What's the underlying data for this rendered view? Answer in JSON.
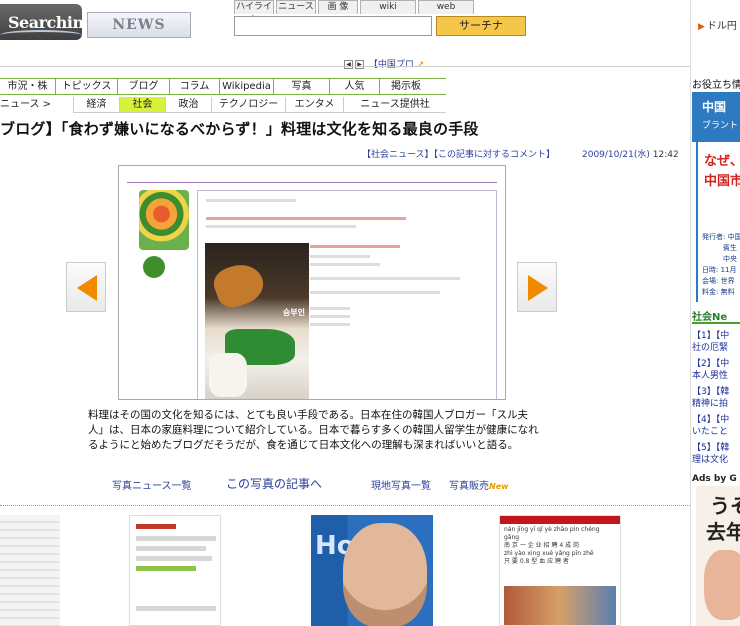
{
  "header": {
    "logo_text": "Searchina",
    "news_logo": "NEWS",
    "search_tabs": [
      "ハイライト",
      "ニュース",
      "画 像",
      "wiki",
      "web"
    ],
    "search_button": "サーチナ",
    "search_placeholder": "",
    "currency_link": "ドル円",
    "currency_icon": "arrow-bullet-icon"
  },
  "pager": {
    "label": "【中国プロ",
    "icon": "arrow-up-right-icon"
  },
  "nav": {
    "primary": [
      "市況・株",
      "トピックス",
      "ブログ",
      "コラム",
      "Wikipedia",
      "写真",
      "人気",
      "掲示板"
    ],
    "secondary_left": "ニュース >",
    "secondary": [
      "経済",
      "社会",
      "政治",
      "テクノロジー",
      "エンタメ",
      "ニュース提供社"
    ],
    "secondary_active": "社会"
  },
  "article": {
    "title": "ブログ】「食わず嫌いになるべからず！」料理は文化を知る最良の手段",
    "category_link": "【社会ニュース】【この記事に対するコメント】",
    "date": "2009/10/21(水)",
    "time": "12:42",
    "photo_caption_overlay": "숭부인",
    "caption": "料理はその国の文化を知るには、とても良い手段である。日本在住の韓国人ブロガー「スル夫人」は、日本の家庭料理について紹介している。日本で暮らす多くの韓国人留学生が健康になれるようにと始めたブログだそうだが、食を通じて日本文化への理解も深まればいいと語る。",
    "links": {
      "photo_news": "写真ニュース一覧",
      "article_of_photo": "この写真の記事へ",
      "local_photos": "現地写真一覧",
      "photo_sales": "写真販売",
      "new_badge": "New"
    }
  },
  "thumbnails": {
    "t4_lines": [
      "nán jīng yī qǐ yè zhāo pìn  chéng gǎng",
      "南 京 一 企 业 招 聘 4 成  岗",
      "zhì yào   xing xué yǎng pīn zhē",
      "只 要 0.8 型 血 应 聘 者"
    ],
    "t3_text": "Ho"
  },
  "sidebar": {
    "title": "お役立ち情",
    "ad_blue_l1": "中国",
    "ad_blue_l2": "ブラント",
    "ad_white_l1": "なぜ、",
    "ad_white_l2": "中国市",
    "ad_info": [
      "発行者: 中国",
      "　　　賓生",
      "　　　中央",
      "日時: 11月",
      "会場: 世界",
      "料金: 無料"
    ],
    "news_head": "社会Ne",
    "news_items": [
      "【1】【中",
      "社の厄緊",
      "【2】【中",
      "本人男性",
      "【3】【韓",
      "精神に拍",
      "【4】【中",
      "いたこと",
      "【5】【韓",
      "理は文化"
    ],
    "ads_by": "Ads by G",
    "ad_uso_l1": "うそ",
    "ad_uso_l2": "去年"
  }
}
